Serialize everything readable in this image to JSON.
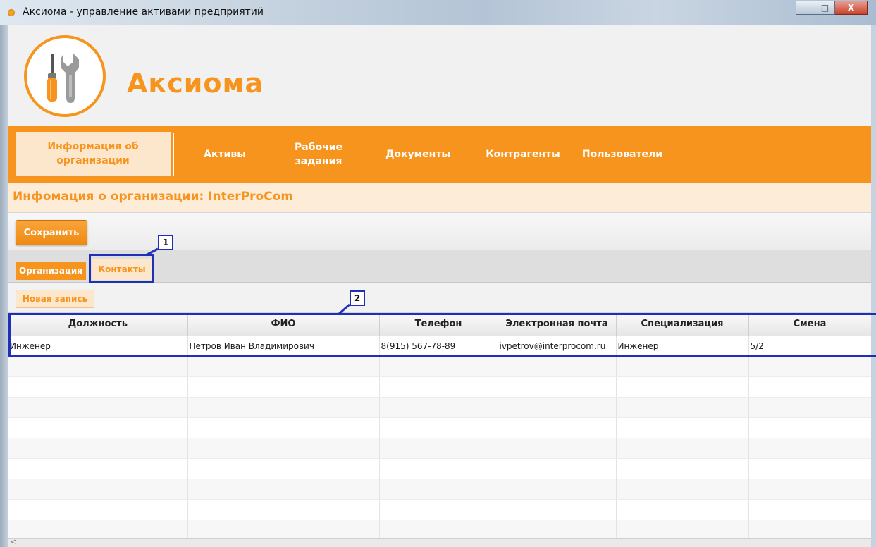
{
  "window": {
    "title": "Аксиома - управление активами предприятий",
    "controls": {
      "minimize": "—",
      "maximize": "□",
      "close": "X"
    }
  },
  "brand": {
    "name": "Аксиома",
    "logo_icon": "tools-icon",
    "accent_color": "#f7941d"
  },
  "nav": {
    "active": {
      "line1": "Информация об",
      "line2": "организации"
    },
    "items": [
      {
        "id": "assets",
        "line1": "Активы",
        "line2": ""
      },
      {
        "id": "tasks",
        "line1": "Рабочие",
        "line2": "задания"
      },
      {
        "id": "documents",
        "line1": "Документы",
        "line2": ""
      },
      {
        "id": "contractors",
        "line1": "Контрагенты",
        "line2": ""
      },
      {
        "id": "users",
        "line1": "Пользователи",
        "line2": ""
      }
    ]
  },
  "page": {
    "title": "Инфомация о организации: InterProCom"
  },
  "toolbar": {
    "save_label": "Сохранить"
  },
  "tabs": {
    "organization": "Организация",
    "contacts": "Контакты"
  },
  "records": {
    "new_label": "Новая запись"
  },
  "table": {
    "columns": [
      "Должность",
      "ФИО",
      "Телефон",
      "Электронная почта",
      "Специализация",
      "Смена"
    ],
    "rows": [
      [
        "Инженер",
        "Петров Иван Владимирович",
        "8(915) 567-78-89",
        "ivpetrov@interprocom.ru",
        "Инженер",
        "5/2"
      ]
    ]
  },
  "annotations": {
    "label1": "1",
    "label2": "2"
  },
  "scrollbar": {
    "arrow": "<"
  }
}
